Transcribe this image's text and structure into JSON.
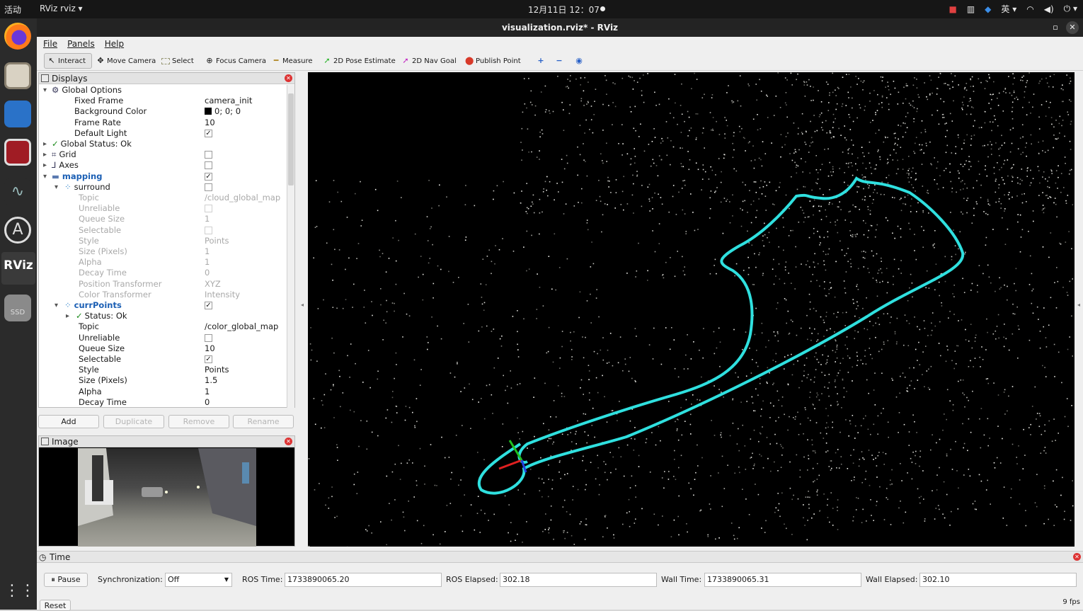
{
  "topbar": {
    "activities": "活动",
    "app_menu": "RViz rviz ▾",
    "clock": "12月11日 12：07",
    "ime": "英 ▾"
  },
  "window": {
    "title": "visualization.rviz* - RViz"
  },
  "menu": [
    "File",
    "Panels",
    "Help"
  ],
  "toolbar": {
    "interact": "Interact",
    "move_camera": "Move Camera",
    "select": "Select",
    "focus_camera": "Focus Camera",
    "measure": "Measure",
    "pose_estimate": "2D Pose Estimate",
    "nav_goal": "2D Nav Goal",
    "publish_point": "Publish Point"
  },
  "displays": {
    "title": "Displays",
    "rows": [
      {
        "label": "Global Options",
        "indent": 0,
        "expand": "down",
        "icon": "gear"
      },
      {
        "label": "Fixed Frame",
        "indent": 1,
        "value": "camera_init"
      },
      {
        "label": "Background Color",
        "indent": 1,
        "value": "0; 0; 0",
        "swatch": true
      },
      {
        "label": "Frame Rate",
        "indent": 1,
        "value": "10"
      },
      {
        "label": "Default Light",
        "indent": 1,
        "check": true
      },
      {
        "label": "Global Status: Ok",
        "indent": 0,
        "expand": "right",
        "ok": true
      },
      {
        "label": "Grid",
        "indent": 0,
        "expand": "right",
        "check": false,
        "icon": "grid"
      },
      {
        "label": "Axes",
        "indent": 0,
        "expand": "right",
        "check": false,
        "icon": "axes"
      },
      {
        "label": "mapping",
        "indent": 0,
        "expand": "down",
        "check": true,
        "icon": "folder",
        "blue": true
      },
      {
        "label": "surround",
        "indent": 1,
        "expand": "down",
        "check": false,
        "icon": "points"
      },
      {
        "label": "Topic",
        "indent": 2,
        "value": "/cloud_global_map",
        "dim": true
      },
      {
        "label": "Unreliable",
        "indent": 2,
        "check": false,
        "dim": true
      },
      {
        "label": "Queue Size",
        "indent": 2,
        "value": "1",
        "dim": true
      },
      {
        "label": "Selectable",
        "indent": 2,
        "check": false,
        "dim": true
      },
      {
        "label": "Style",
        "indent": 2,
        "value": "Points",
        "dim": true
      },
      {
        "label": "Size (Pixels)",
        "indent": 2,
        "value": "1",
        "dim": true
      },
      {
        "label": "Alpha",
        "indent": 2,
        "value": "1",
        "dim": true
      },
      {
        "label": "Decay Time",
        "indent": 2,
        "value": "0",
        "dim": true
      },
      {
        "label": "Position Transformer",
        "indent": 2,
        "value": "XYZ",
        "dim": true
      },
      {
        "label": "Color Transformer",
        "indent": 2,
        "value": "Intensity",
        "dim": true
      },
      {
        "label": "currPoints",
        "indent": 1,
        "expand": "down",
        "check": true,
        "icon": "points",
        "blue": true
      },
      {
        "label": "Status: Ok",
        "indent": 2,
        "expand": "right",
        "ok": true
      },
      {
        "label": "Topic",
        "indent": 2,
        "value": "/color_global_map"
      },
      {
        "label": "Unreliable",
        "indent": 2,
        "check": false
      },
      {
        "label": "Queue Size",
        "indent": 2,
        "value": "10"
      },
      {
        "label": "Selectable",
        "indent": 2,
        "check": true
      },
      {
        "label": "Style",
        "indent": 2,
        "value": "Points"
      },
      {
        "label": "Size (Pixels)",
        "indent": 2,
        "value": "1.5"
      },
      {
        "label": "Alpha",
        "indent": 2,
        "value": "1"
      },
      {
        "label": "Decay Time",
        "indent": 2,
        "value": "0"
      }
    ],
    "buttons": {
      "add": "Add",
      "duplicate": "Duplicate",
      "remove": "Remove",
      "rename": "Rename"
    }
  },
  "image_panel": {
    "title": "Image"
  },
  "time_panel": {
    "title": "Time",
    "pause": "Pause",
    "sync_label": "Synchronization:",
    "sync_value": "Off",
    "ros_time_label": "ROS Time:",
    "ros_time": "1733890065.20",
    "ros_elapsed_label": "ROS Elapsed:",
    "ros_elapsed": "302.18",
    "wall_time_label": "Wall Time:",
    "wall_time": "1733890065.31",
    "wall_elapsed_label": "Wall Elapsed:",
    "wall_elapsed": "302.10",
    "reset": "Reset",
    "fps": "9 fps"
  },
  "colors": {
    "trajectory": "#2fe0df",
    "background": "#000000",
    "status_ok": "#1a8a1a"
  }
}
